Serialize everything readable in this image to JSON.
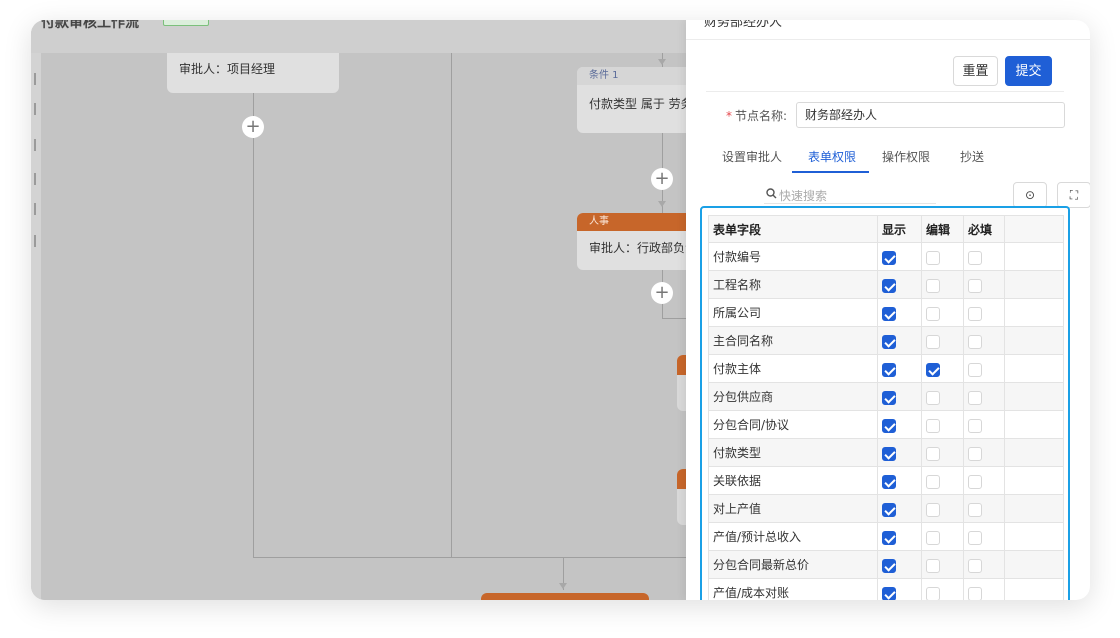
{
  "canvas": {
    "title_fragment": "付款审核工作流",
    "approver_card": {
      "text": "审批人：项目经理"
    },
    "condition_card": {
      "header": "条件 1",
      "text": "付款类型 属于 劳务"
    },
    "hr_card": {
      "header": "人事",
      "text": "审批人：行政部负责人"
    },
    "plus_symbol": "+"
  },
  "drawer": {
    "title": "财务部经办人",
    "buttons": {
      "reset": "重置",
      "submit": "提交"
    },
    "node_name": {
      "required_mark": "*",
      "label": "节点名称:",
      "value": "财务部经办人"
    },
    "tabs": [
      {
        "label": "设置审批人"
      },
      {
        "label": "表单权限"
      },
      {
        "label": "操作权限"
      },
      {
        "label": "抄送"
      }
    ],
    "search": {
      "icon": "search-icon",
      "placeholder": "快速搜索"
    },
    "settings_icon": "⊙",
    "fullscreen_icon": "⛶",
    "table": {
      "headers": {
        "field": "表单字段",
        "show": "显示",
        "edit": "编辑",
        "required": "必填"
      },
      "rows": [
        {
          "field": "付款编号",
          "show": true,
          "edit": false,
          "required": false
        },
        {
          "field": "工程名称",
          "show": true,
          "edit": false,
          "required": false
        },
        {
          "field": "所属公司",
          "show": true,
          "edit": false,
          "required": false
        },
        {
          "field": "主合同名称",
          "show": true,
          "edit": false,
          "required": false
        },
        {
          "field": "付款主体",
          "show": true,
          "edit": true,
          "required": false
        },
        {
          "field": "分包供应商",
          "show": true,
          "edit": false,
          "required": false
        },
        {
          "field": "分包合同/协议",
          "show": true,
          "edit": false,
          "required": false
        },
        {
          "field": "付款类型",
          "show": true,
          "edit": false,
          "required": false
        },
        {
          "field": "关联依据",
          "show": true,
          "edit": false,
          "required": false
        },
        {
          "field": "对上产值",
          "show": true,
          "edit": false,
          "required": false
        },
        {
          "field": "产值/预计总收入",
          "show": true,
          "edit": false,
          "required": false
        },
        {
          "field": "分包合同最新总价",
          "show": true,
          "edit": false,
          "required": false
        },
        {
          "field": "产值/成本对账",
          "show": true,
          "edit": false,
          "required": false
        }
      ]
    }
  },
  "colors": {
    "accent": "#1f5fd6",
    "highlight_border": "#1aa0e6",
    "hr_header": "#c7662a"
  }
}
